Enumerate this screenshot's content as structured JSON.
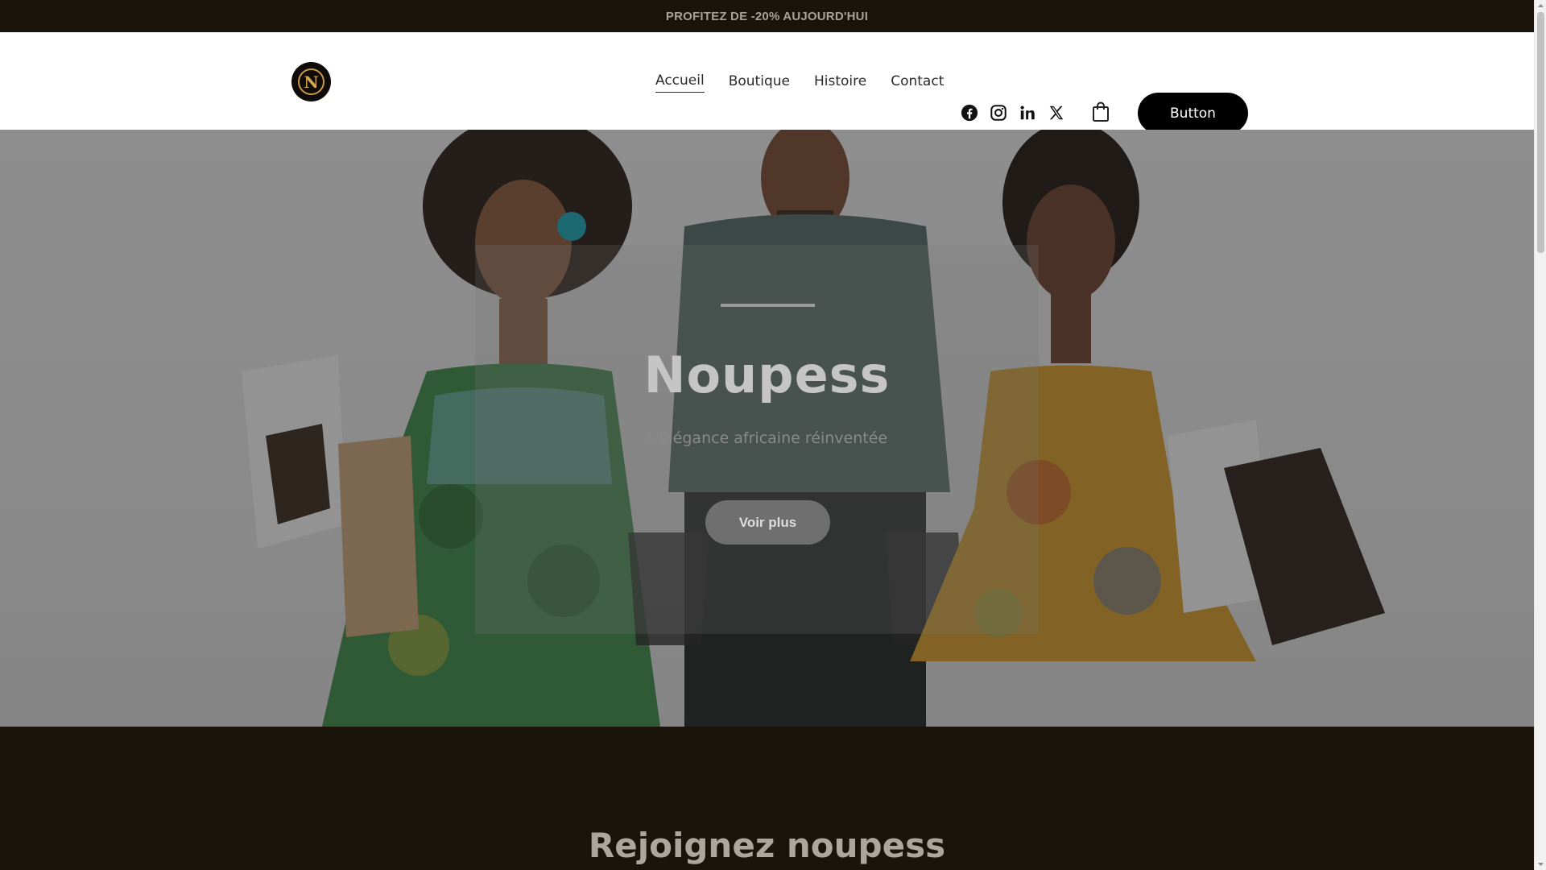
{
  "announcement": {
    "text": "PROFITEZ DE -20% AUJOURD'HUI"
  },
  "header": {
    "logo_letter": "N",
    "nav": [
      {
        "label": "Accueil",
        "active": true
      },
      {
        "label": "Boutique",
        "active": false
      },
      {
        "label": "Histoire",
        "active": false
      },
      {
        "label": "Contact",
        "active": false
      }
    ],
    "social": [
      "facebook-icon",
      "instagram-icon",
      "linkedin-icon",
      "x-icon"
    ],
    "cart_icon": "shopping-bag-icon",
    "cta_label": "Button"
  },
  "hero": {
    "title": "Noupess",
    "subtitle": "L'élégance africaine réinventée",
    "button_label": "Voir plus"
  },
  "join": {
    "title": "Rejoignez noupess"
  },
  "colors": {
    "dark": "#1b140b",
    "accent_gold": "#d8a84e",
    "cta": "#000000"
  }
}
